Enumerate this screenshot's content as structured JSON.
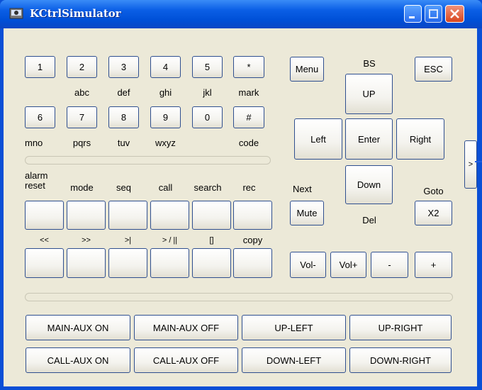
{
  "window": {
    "title": "KCtrlSimulator"
  },
  "keypad": {
    "row1": [
      "1",
      "2",
      "3",
      "4",
      "5",
      "*"
    ],
    "row1_sub": [
      "",
      "abc",
      "def",
      "ghi",
      "jkl",
      "mark"
    ],
    "row2": [
      "6",
      "7",
      "8",
      "9",
      "0",
      "#"
    ],
    "row2_sub": [
      "mno",
      "pqrs",
      "tuv",
      "wxyz",
      "",
      "code"
    ]
  },
  "function_labels": {
    "alarm_reset": "alarm\nreset",
    "mode": "mode",
    "seq": "seq",
    "call": "call",
    "search": "search",
    "rec": "rec"
  },
  "transport_labels": [
    "<<",
    ">>",
    ">|",
    "> / ||",
    "[]",
    "copy"
  ],
  "nav": {
    "menu": "Menu",
    "esc": "ESC",
    "bs": "BS",
    "up": "UP",
    "left": "Left",
    "enter": "Enter",
    "right": "Right",
    "down": "Down",
    "next": "Next",
    "mute": "Mute",
    "del": "Del",
    "goto": "Goto",
    "x2": "X2"
  },
  "volume": {
    "vol_minus": "Vol-",
    "vol_plus": "Vol+",
    "minus": "-",
    "plus": "+"
  },
  "side_toggle": ">",
  "aux": {
    "main_aux_on": "MAIN-AUX ON",
    "main_aux_off": "MAIN-AUX OFF",
    "up_left": "UP-LEFT",
    "up_right": "UP-RIGHT",
    "call_aux_on": "CALL-AUX ON",
    "call_aux_off": "CALL-AUX OFF",
    "down_left": "DOWN-LEFT",
    "down_right": "DOWN-RIGHT"
  }
}
